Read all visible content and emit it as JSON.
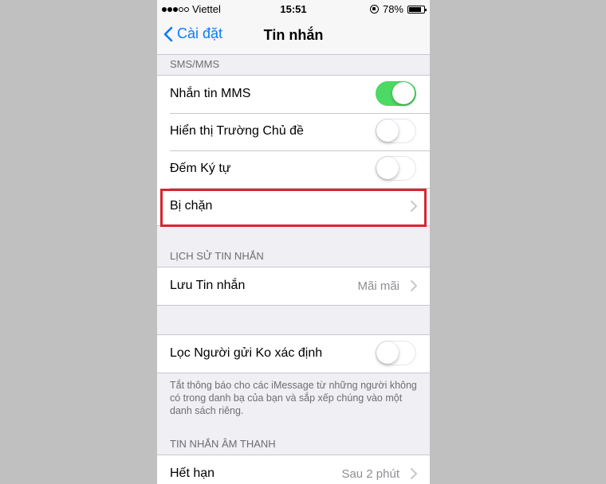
{
  "status_bar": {
    "carrier": "Viettel",
    "time": "15:51",
    "battery": "78%"
  },
  "nav": {
    "back_label": "Cài đặt",
    "title": "Tin nhắn"
  },
  "sms_section": {
    "header": "SMS/MMS",
    "rows": [
      {
        "label": "Nhắn tin MMS",
        "toggle": true
      },
      {
        "label": "Hiển thị Trường Chủ đề",
        "toggle": false
      },
      {
        "label": "Đếm Ký tự",
        "toggle": false
      },
      {
        "label": "Bị chặn"
      }
    ]
  },
  "history_section": {
    "header": "LỊCH SỬ TIN NHẮN",
    "keep_label": "Lưu Tin nhắn",
    "keep_value": "Mãi mãi"
  },
  "filter_section": {
    "label": "Lọc Người gửi Ko xác định",
    "toggle": false,
    "footnote": "Tắt thông báo cho các iMessage từ những người không có trong danh bạ của bạn và sắp xếp chúng vào một danh sách riêng."
  },
  "audio_section": {
    "header": "TIN NHẮN ÂM THANH",
    "expire_label": "Hết hạn",
    "expire_value": "Sau 2 phút"
  },
  "colors": {
    "accent": "#0a7aff",
    "toggle_on": "#4cd964",
    "highlight": "#d9252f"
  }
}
